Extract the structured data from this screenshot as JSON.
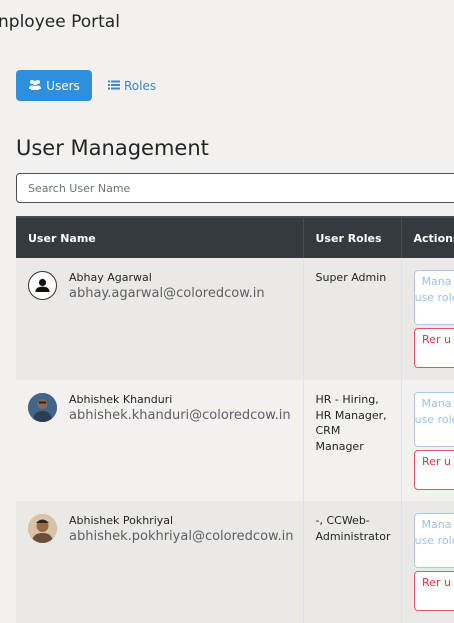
{
  "header": {
    "title": "nployee Portal"
  },
  "tabs": [
    {
      "label": "Users",
      "icon": "users-icon",
      "active": true
    },
    {
      "label": "Roles",
      "icon": "list-icon",
      "active": false
    }
  ],
  "main": {
    "heading": "User Management",
    "search": {
      "placeholder": "Search User Name",
      "value": ""
    },
    "table": {
      "columns": [
        "User Name",
        "User Roles",
        "Actions"
      ],
      "rows": [
        {
          "name": "Abhay Agarwal",
          "email": "abhay.agarwal@coloredcow.in",
          "roles": "Super Admin",
          "avatar": "default-user-icon",
          "manage_label": "Mana use role",
          "remove_label": "Rer u"
        },
        {
          "name": "Abhishek Khanduri",
          "email": "abhishek.khanduri@coloredcow.in",
          "roles": "HR - Hiring, HR Manager, CRM Manager",
          "avatar": "user-photo",
          "manage_label": "Mana use role",
          "remove_label": "Rer u"
        },
        {
          "name": "Abhishek Pokhriyal",
          "email": "abhishek.pokhriyal@coloredcow.in",
          "roles": "-, CCWeb-Administrator",
          "avatar": "user-photo",
          "manage_label": "Mana use role",
          "remove_label": "Rer u"
        }
      ]
    }
  },
  "colors": {
    "primary": "#2f8fdc",
    "header_dark": "#343a40",
    "danger": "#dc3545",
    "background": "#f3f1ee"
  }
}
